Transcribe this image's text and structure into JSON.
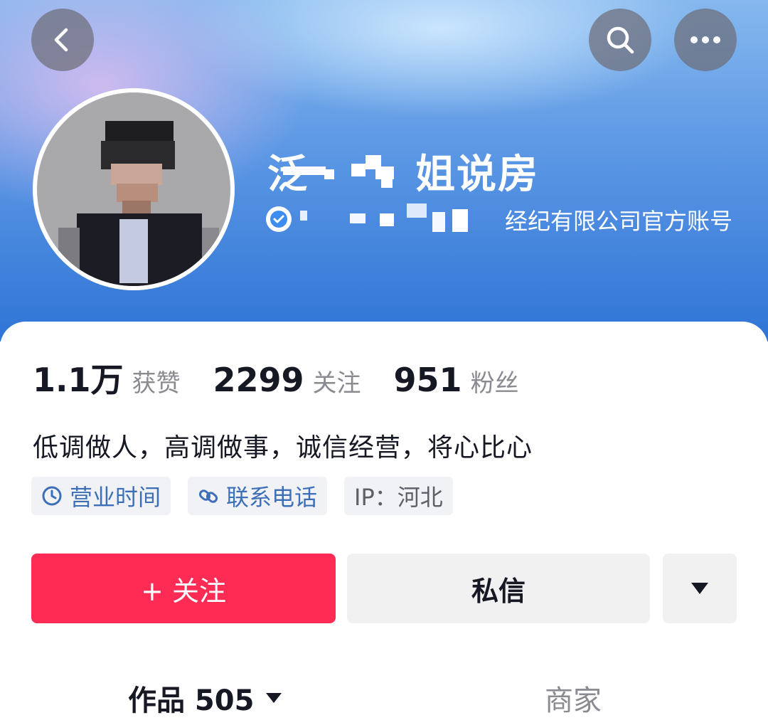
{
  "header": {
    "back_icon": "chevron-left-icon",
    "search_icon": "search-icon",
    "more_icon": "more-horizontal-icon"
  },
  "profile": {
    "name_visible": "姐说房",
    "name_first_char": "泛",
    "verified_icon": "verified-check-icon",
    "verification_text": "经纪有限公司官方账号"
  },
  "stats": {
    "likes_value": "1.1万",
    "likes_label": "获赞",
    "following_value": "2299",
    "following_label": "关注",
    "followers_value": "951",
    "followers_label": "粉丝"
  },
  "bio": "低调做人，高调做事，诚信经营，将心比心",
  "tags": {
    "hours_icon": "clock-icon",
    "hours_label": "营业时间",
    "phone_icon": "link-icon",
    "phone_label": "联系电话",
    "ip_label": "IP：河北"
  },
  "actions": {
    "follow_label": "+ 关注",
    "message_label": "私信",
    "more_icon": "caret-down-icon"
  },
  "tabs": {
    "works_label": "作品 505",
    "works_icon": "caret-down-icon",
    "shop_label": "商家"
  },
  "colors": {
    "accent_red": "#fe2c55",
    "link_blue": "#3d6fb8",
    "header_blue": "#2f74d6"
  }
}
